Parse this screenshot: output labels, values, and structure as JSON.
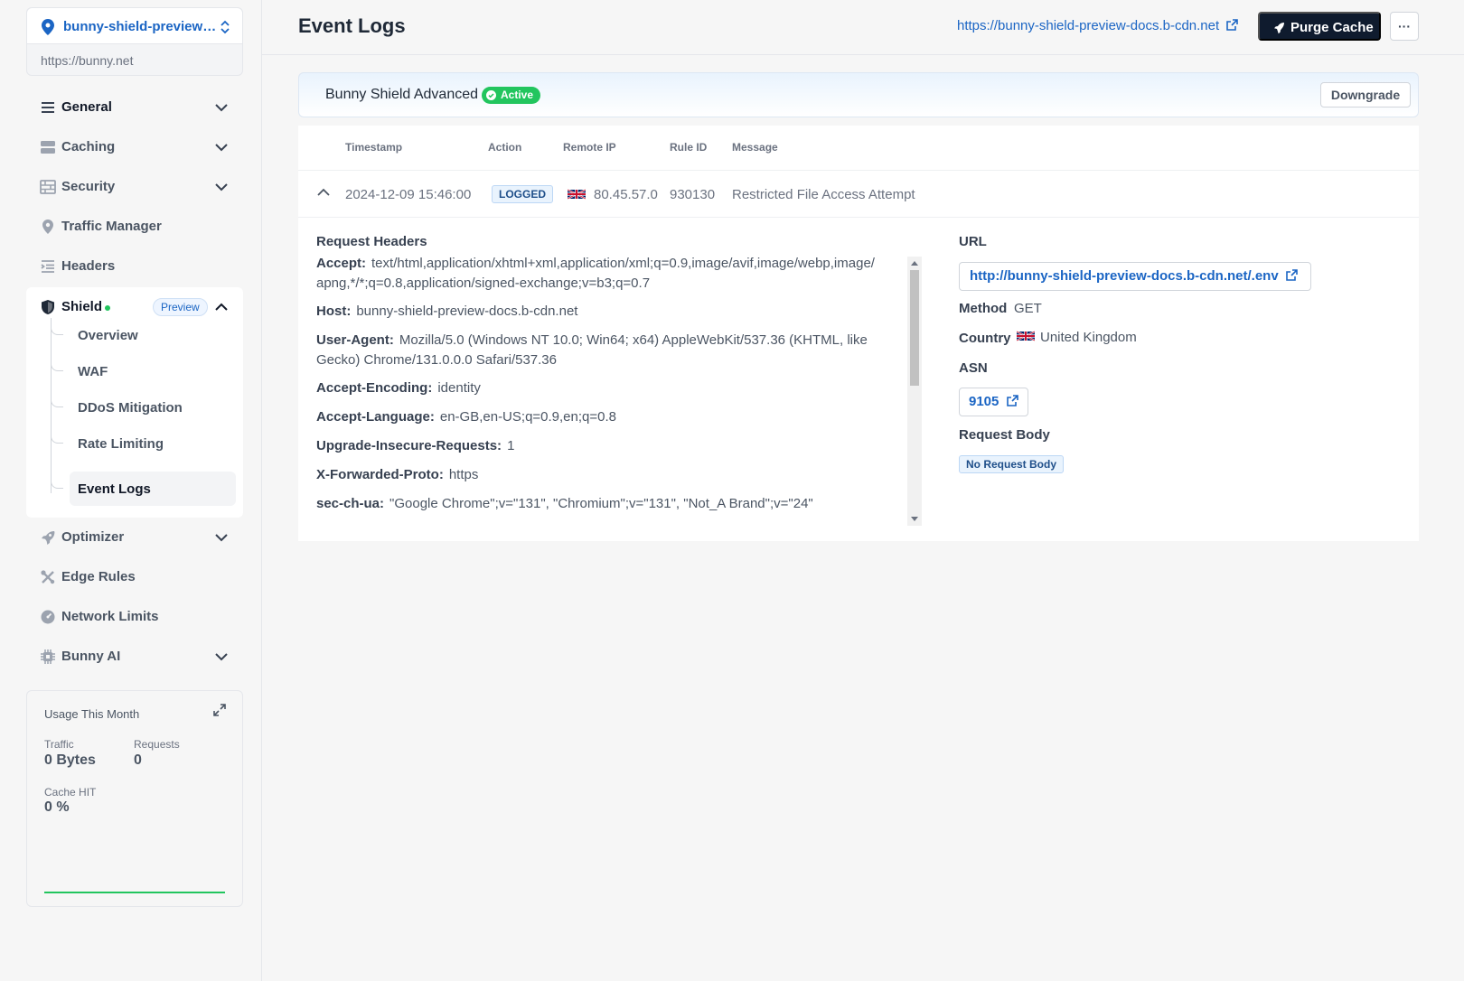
{
  "zone": {
    "name": "bunny-shield-preview-docs",
    "url": "https://bunny.net"
  },
  "nav": {
    "general": "General",
    "caching": "Caching",
    "security": "Security",
    "traffic_manager": "Traffic Manager",
    "headers": "Headers",
    "shield": "Shield",
    "shield_badge": "Preview",
    "shield_items": [
      "Overview",
      "WAF",
      "DDoS Mitigation",
      "Rate Limiting",
      "Event Logs"
    ],
    "optimizer": "Optimizer",
    "edge_rules": "Edge Rules",
    "network_limits": "Network Limits",
    "bunny_ai": "Bunny AI"
  },
  "usage": {
    "title": "Usage This Month",
    "traffic_label": "Traffic",
    "traffic_value": "0 Bytes",
    "requests_label": "Requests",
    "requests_value": "0",
    "cache_label": "Cache HIT",
    "cache_value": "0 %"
  },
  "header": {
    "title": "Event Logs",
    "docs_link": "https://bunny-shield-preview-docs.b-cdn.net",
    "purge_label": "Purge Cache",
    "more_label": "···"
  },
  "plan": {
    "name": "Bunny Shield Advanced",
    "status": "Active",
    "downgrade_label": "Downgrade"
  },
  "table": {
    "columns": [
      "Timestamp",
      "Action",
      "Remote IP",
      "Rule ID",
      "Message"
    ],
    "row": {
      "timestamp": "2024-12-09 15:46:00",
      "action": "LOGGED",
      "remote_ip": "80.45.57.0",
      "rule_id": "930130",
      "message": "Restricted File Access Attempt"
    }
  },
  "detail": {
    "headers_title": "Request Headers",
    "headers": [
      {
        "key": "Accept:",
        "value": "text/html,application/xhtml+xml,application/xml;q=0.9,image/avif,image/webp,image/apng,*/*;q=0.8,application/signed-exchange;v=b3;q=0.7"
      },
      {
        "key": "Host:",
        "value": "bunny-shield-preview-docs.b-cdn.net"
      },
      {
        "key": "User-Agent:",
        "value": "Mozilla/5.0 (Windows NT 10.0; Win64; x64) AppleWebKit/537.36 (KHTML, like Gecko) Chrome/131.0.0.0 Safari/537.36"
      },
      {
        "key": "Accept-Encoding:",
        "value": "identity"
      },
      {
        "key": "Accept-Language:",
        "value": "en-GB,en-US;q=0.9,en;q=0.8"
      },
      {
        "key": "Upgrade-Insecure-Requests:",
        "value": "1"
      },
      {
        "key": "X-Forwarded-Proto:",
        "value": "https"
      },
      {
        "key": "sec-ch-ua:",
        "value": "\"Google Chrome\";v=\"131\", \"Chromium\";v=\"131\", \"Not_A Brand\";v=\"24\""
      }
    ],
    "url_label": "URL",
    "url_value": "http://bunny-shield-preview-docs.b-cdn.net/.env",
    "method_label": "Method",
    "method_value": "GET",
    "country_label": "Country",
    "country_value": "United Kingdom",
    "asn_label": "ASN",
    "asn_value": "9105",
    "body_label": "Request Body",
    "body_value": "No Request Body"
  },
  "colors": {
    "accent": "#1b65c4",
    "dark_button": "#0f1b2e",
    "success": "#22c55e"
  }
}
